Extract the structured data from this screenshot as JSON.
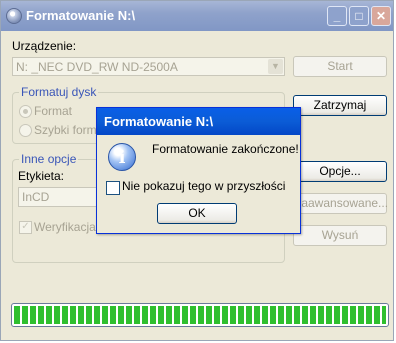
{
  "window": {
    "title": "Formatowanie N:\\"
  },
  "caption_buttons": {
    "minimize": "_",
    "maximize": "□",
    "close": "✕"
  },
  "device": {
    "label": "Urządzenie:",
    "selected": "N: _NEC DVD_RW ND-2500A",
    "start_label": "Start",
    "stop_label": "Zatrzymaj"
  },
  "format_group": {
    "legend": "Formatuj dysk",
    "options": [
      "Format",
      "Szybki format"
    ]
  },
  "other_group": {
    "legend": "Inne opcje",
    "label_caption": "Etykieta:",
    "label_value": "InCD",
    "verify_label": "Weryfikacja"
  },
  "side_buttons": {
    "options": "Opcje...",
    "advanced": "Zaawansowane...",
    "eject": "Wysuń"
  },
  "progress": {
    "fraction": 1.0
  },
  "dialog": {
    "title": "Formatowanie N:\\",
    "message": "Formatowanie zakończone!",
    "checkbox_label": "Nie pokazuj tego w przyszłości",
    "ok_label": "OK",
    "icon": "info-icon"
  }
}
